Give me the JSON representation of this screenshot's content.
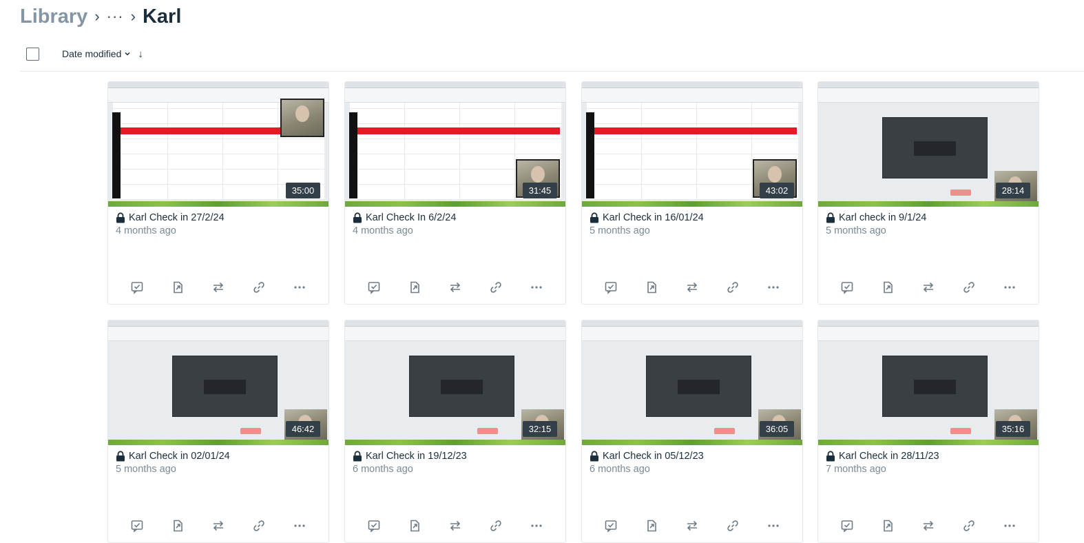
{
  "breadcrumb": {
    "root": "Library",
    "separator": "›",
    "ellipsis": "···",
    "current": "Karl"
  },
  "toolbar": {
    "sort_label": "Date modified",
    "sort_dropdown_icon": "chevron-down-icon",
    "sort_direction_icon": "arrow-down-icon",
    "sort_direction_glyph": "↓"
  },
  "colors": {
    "duration_badge_bg": "#333f48",
    "subtitle_text": "#7b8a95",
    "breadcrumb_root": "#8496a3",
    "action_icon": "#6d7b86"
  },
  "actions": [
    "comment-icon",
    "share-icon",
    "move-icon",
    "link-icon",
    "more-icon"
  ],
  "videos": [
    {
      "title": "Karl Check in 27/2/24",
      "age": "4 months ago",
      "duration": "35:00",
      "thumb": "sheet"
    },
    {
      "title": "Karl Check In 6/2/24",
      "age": "4 months ago",
      "duration": "31:45",
      "thumb": "doc"
    },
    {
      "title": "Karl Check in 16/01/24",
      "age": "5 months ago",
      "duration": "43:02",
      "thumb": "sheet"
    },
    {
      "title": "Karl check in 9/1/24",
      "age": "5 months ago",
      "duration": "28:14",
      "thumb": "modal"
    },
    {
      "title": "Karl Check in 02/01/24",
      "age": "5 months ago",
      "duration": "46:42",
      "thumb": "modal"
    },
    {
      "title": "Karl Check in 19/12/23",
      "age": "6 months ago",
      "duration": "32:15",
      "thumb": "modal"
    },
    {
      "title": "Karl Check in 05/12/23",
      "age": "6 months ago",
      "duration": "36:05",
      "thumb": "modal"
    },
    {
      "title": "Karl Check in 28/11/23",
      "age": "7 months ago",
      "duration": "35:16",
      "thumb": "modal"
    }
  ]
}
